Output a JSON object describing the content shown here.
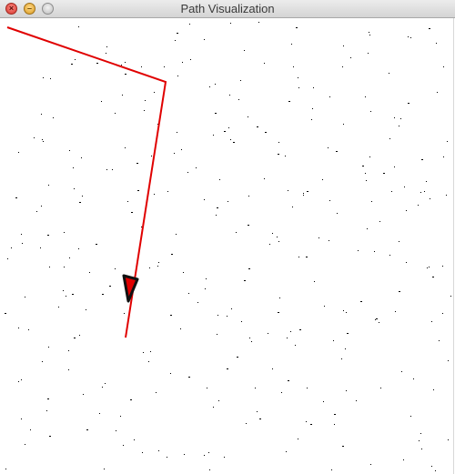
{
  "window": {
    "title": "Path Visualization"
  },
  "controls": {
    "close_icon": "close-icon",
    "minimize_icon": "minimize-icon",
    "zoom_icon": "zoom-icon",
    "close_glyph": "×",
    "minimize_glyph": "–"
  },
  "colors": {
    "path": "#e00000",
    "marker_fill": "#e00000",
    "marker_outline": "#111111",
    "obstacle_dots": "#000000",
    "background": "#ffffff"
  }
}
